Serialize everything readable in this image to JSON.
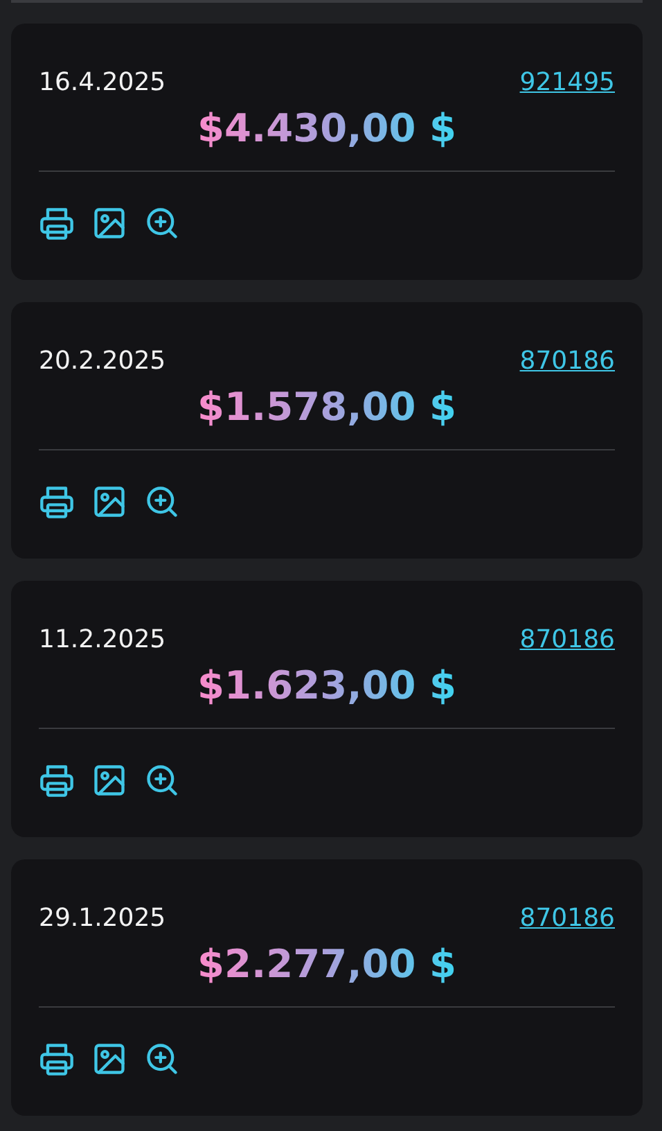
{
  "receipts": [
    {
      "date": "16.4.2025",
      "number": "921495",
      "amount": "$4.430,00 $"
    },
    {
      "date": "20.2.2025",
      "number": "870186",
      "amount": "$1.578,00 $"
    },
    {
      "date": "11.2.2025",
      "number": "870186",
      "amount": "$1.623,00 $"
    },
    {
      "date": "29.1.2025",
      "number": "870186",
      "amount": "$2.277,00 $"
    }
  ]
}
